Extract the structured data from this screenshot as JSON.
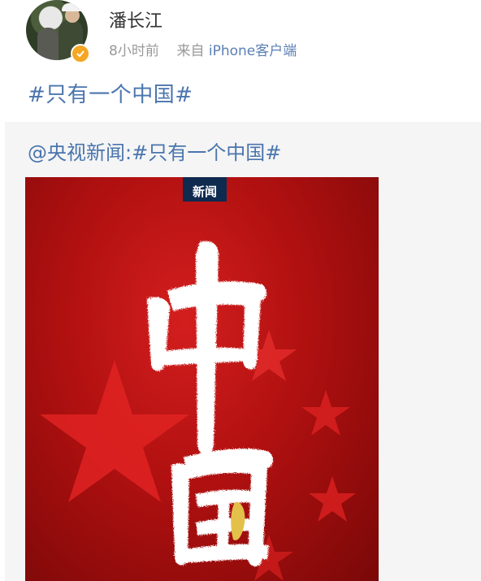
{
  "user": {
    "name": "潘长江",
    "time": "8小时前",
    "from_prefix": "来自",
    "source": "iPhone客户端"
  },
  "post": {
    "text": "#只有一个中国#"
  },
  "repost": {
    "text": "@央视新闻:#只有一个中国#",
    "image": {
      "logo_text": "新闻",
      "calligraphy": "中国"
    }
  },
  "colors": {
    "link": "#4a75ad",
    "poster_red": "#b01010",
    "badge": "#f5a623"
  }
}
